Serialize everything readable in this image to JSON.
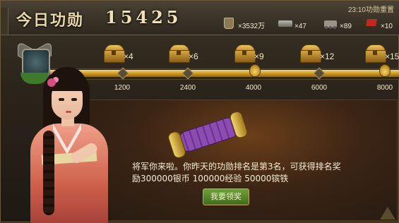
{
  "header": {
    "title": "今日功勋",
    "score": "15425",
    "reset_time": "23:10功勋重置"
  },
  "resources": [
    {
      "icon": "soldier-icon",
      "value": "×3532万"
    },
    {
      "icon": "ingot-icon",
      "value": "×47"
    },
    {
      "icon": "cart-icon",
      "value": "×89"
    },
    {
      "icon": "flag-icon",
      "value": "×10"
    }
  ],
  "rewards": [
    {
      "multiplier": "×4",
      "threshold": "1200"
    },
    {
      "multiplier": "×6",
      "threshold": "2400"
    },
    {
      "multiplier": "×9",
      "threshold": "4000"
    },
    {
      "multiplier": "×12",
      "threshold": "6000"
    },
    {
      "multiplier": "×15",
      "threshold": "8000"
    }
  ],
  "progress": {
    "current": 15425,
    "max": 8000,
    "fill_fraction": 1.0
  },
  "panel": {
    "message": "将军你来啦。你昨天的功勋排名是第3名，可获得排名奖励300000银币 100000经验 50000镔铁",
    "claim_button": "我要领奖"
  },
  "colors": {
    "bar_fill": "#e0ab34",
    "button_green": "#4f8026",
    "title_text": "#e8d7a8"
  }
}
